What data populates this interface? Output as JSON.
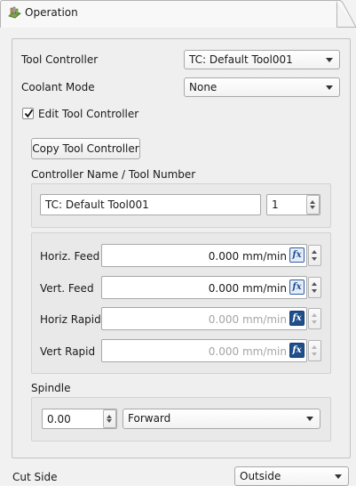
{
  "tab": {
    "title": "Operation",
    "icon": "operation-icon"
  },
  "form": {
    "tool_controller": {
      "label": "Tool Controller",
      "value": "TC: Default Tool001"
    },
    "coolant_mode": {
      "label": "Coolant Mode",
      "value": "None"
    },
    "edit_tool_controller": {
      "label": "Edit Tool Controller",
      "checked": true
    },
    "copy_button": "Copy Tool Controller",
    "name_header": "Controller Name /  Tool Number",
    "controller_name": "TC: Default Tool001",
    "tool_number": "1",
    "feeds": [
      {
        "label": "Horiz. Feed",
        "value": "0.000 mm/min",
        "enabled": true
      },
      {
        "label": "Vert. Feed",
        "value": "0.000 mm/min",
        "enabled": true
      },
      {
        "label": "Horiz Rapid",
        "value": "0.000 mm/min",
        "enabled": false
      },
      {
        "label": "Vert Rapid",
        "value": "0.000 mm/min",
        "enabled": false
      }
    ],
    "spindle": {
      "label": "Spindle",
      "speed": "0.00",
      "direction": "Forward"
    },
    "cut_side": {
      "label": "Cut Side",
      "value": "Outside"
    }
  },
  "colors": {
    "accent": "#1f4f8c",
    "disabled_text": "#a5a5a5"
  }
}
